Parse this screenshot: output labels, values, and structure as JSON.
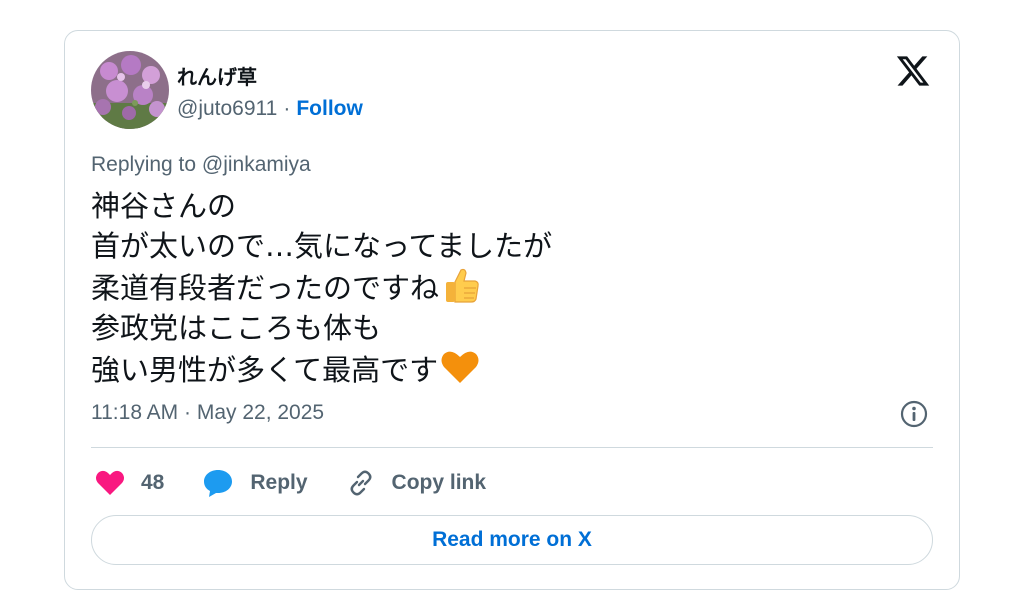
{
  "author": {
    "display_name": "れんげ草",
    "handle": "@juto6911",
    "separator": "·",
    "follow_label": "Follow"
  },
  "reply": {
    "text": "Replying to @jinkamiya"
  },
  "tweet": {
    "lines": [
      "神谷さんの",
      "首が太いので…気になってましたが",
      "柔道有段者だったのですね",
      "参政党はこころも体も",
      "強い男性が多くて最高です"
    ],
    "emojis": [
      "thumbs-up-icon",
      "orange-heart-icon"
    ],
    "timestamp": "11:18 AM · May 22, 2025"
  },
  "actions": {
    "like_count": "48",
    "reply_label": "Reply",
    "copy_label": "Copy link"
  },
  "footer": {
    "read_more_label": "Read more on X"
  },
  "colors": {
    "link": "#006fd6",
    "heart": "#f91880",
    "reply_icon": "#1d9bf0",
    "muted": "#536471",
    "border": "#cfd9de"
  }
}
